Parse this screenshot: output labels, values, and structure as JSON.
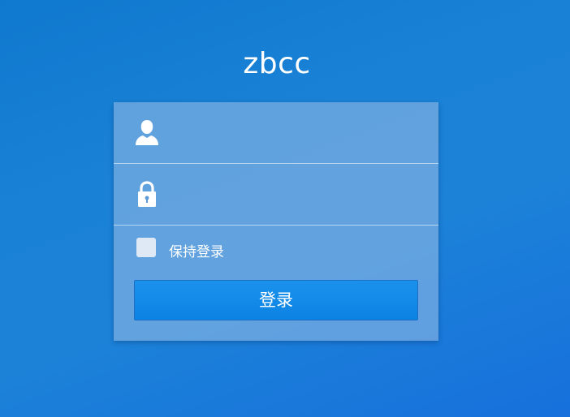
{
  "page": {
    "title": "zbcc"
  },
  "login_form": {
    "username": {
      "icon": "user-icon",
      "value": "",
      "placeholder": ""
    },
    "password": {
      "icon": "lock-icon",
      "value": "",
      "placeholder": ""
    },
    "remember_me": {
      "label": "保持登录",
      "checked": false
    },
    "submit_label": "登录"
  },
  "colors": {
    "background": "#1a82d6",
    "panel": "#9bbee6",
    "button": "#1a92ec",
    "text": "#ffffff"
  }
}
